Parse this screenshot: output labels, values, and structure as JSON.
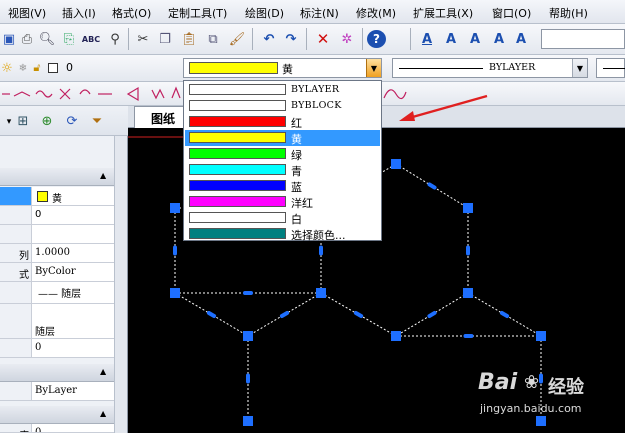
{
  "menu": [
    "视图(V)",
    "插入(I)",
    "格式(O)",
    "定制工具(T)",
    "绘图(D)",
    "标注(N)",
    "修改(M)",
    "扩展工具(X)",
    "窗口(O)",
    "帮助(H)"
  ],
  "layer_combo": {
    "value": "0"
  },
  "color_combo": {
    "value": "黄",
    "swatch": "#ffff00"
  },
  "linetype_combo": {
    "value": "BYLAYER"
  },
  "color_options": [
    {
      "label": "BYLAYER",
      "swatch": "#ffffff",
      "latin": true
    },
    {
      "label": "BYBLOCK",
      "swatch": "#ffffff",
      "latin": true
    },
    {
      "label": "红",
      "swatch": "#ff0000"
    },
    {
      "label": "黄",
      "swatch": "#ffff00",
      "selected": true
    },
    {
      "label": "绿",
      "swatch": "#00ff00"
    },
    {
      "label": "青",
      "swatch": "#00ffff"
    },
    {
      "label": "蓝",
      "swatch": "#0000ff"
    },
    {
      "label": "洋红",
      "swatch": "#ff00ff"
    },
    {
      "label": "白",
      "swatch": "#ffffff"
    },
    {
      "label": "选择颜色...",
      "swatch": "#008080"
    }
  ],
  "drawing_tab": {
    "label": "图纸"
  },
  "properties": {
    "color": "黄",
    "color_swatch": "#ffff00",
    "layer": "0",
    "scale_key": "列",
    "scale": "1.0000",
    "style_key": "式",
    "style": "ByColor",
    "linetype": "—— 随层",
    "lineweight": "随层",
    "thickness": "0",
    "plotstyle": "ByLayer",
    "bottom_key": "度",
    "bottom_val": "0"
  },
  "watermark": {
    "brand": "Bai",
    "brand2": "经验",
    "url": "jingyan.baidu.com"
  },
  "colors": {
    "accent": "#3399ff",
    "vertex": "#1e6fff",
    "arrow": "#e02020"
  }
}
